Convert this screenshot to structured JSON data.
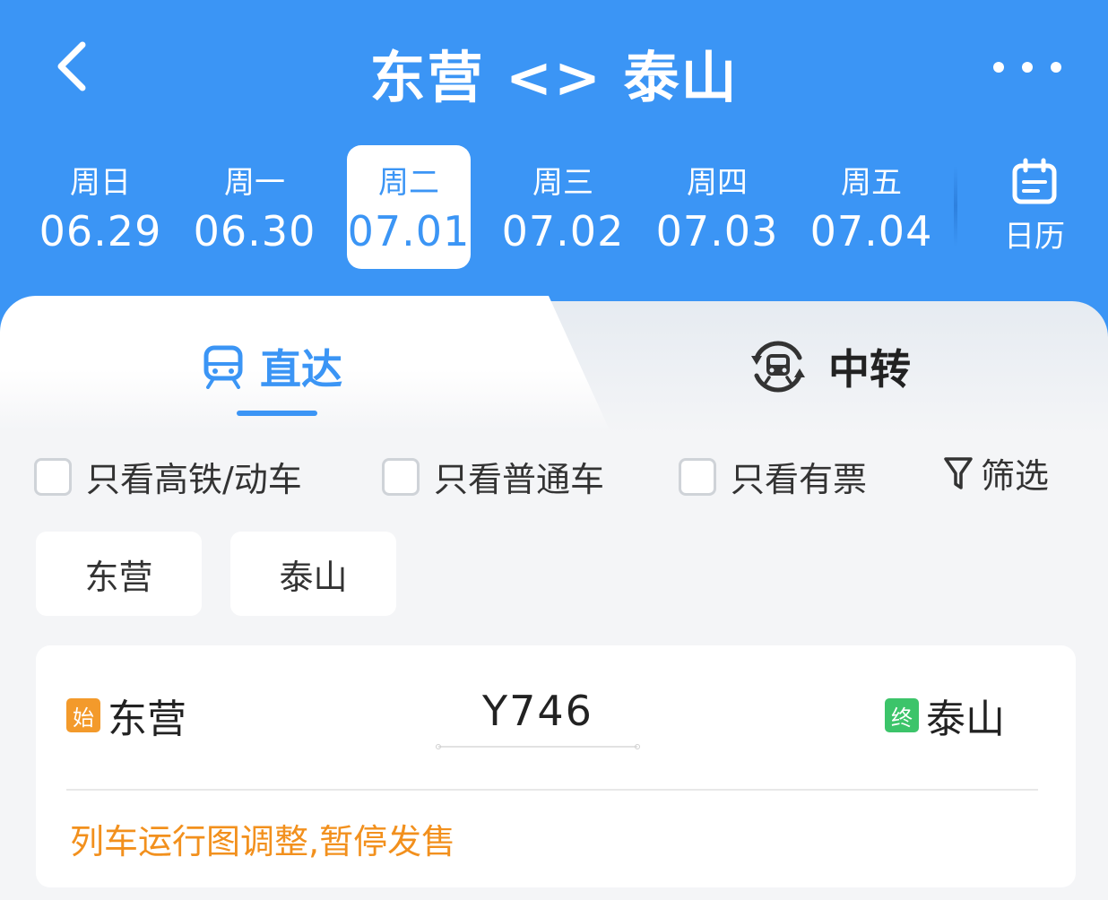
{
  "header": {
    "title": "东营 <> 泰山"
  },
  "dates": [
    {
      "dow": "周日",
      "date": "06.29"
    },
    {
      "dow": "周一",
      "date": "06.30"
    },
    {
      "dow": "周二",
      "date": "07.01"
    },
    {
      "dow": "周三",
      "date": "07.02"
    },
    {
      "dow": "周四",
      "date": "07.03"
    },
    {
      "dow": "周五",
      "date": "07.04"
    }
  ],
  "calendar": {
    "label": "日历"
  },
  "tabs": {
    "direct": "直达",
    "transfer": "中转"
  },
  "filters": {
    "high_speed": "只看高铁/动车",
    "normal": "只看普通车",
    "available": "只看有票",
    "filter_button": "筛选"
  },
  "station_chips": [
    "东营",
    "泰山"
  ],
  "train": {
    "start_badge": "始",
    "from": "东营",
    "number": "Y746",
    "end_badge": "终",
    "to": "泰山",
    "notice": "列车运行图调整,暂停发售"
  },
  "colors": {
    "primary": "#3b95f5",
    "start_badge": "#f39a2b",
    "end_badge": "#3cc46a",
    "notice": "#f2901d"
  },
  "icons": {
    "back": "chevron-left-icon",
    "more": "more-dots-icon",
    "calendar": "calendar-icon",
    "direct": "train-icon",
    "transfer": "transfer-train-icon",
    "filter": "funnel-icon"
  }
}
